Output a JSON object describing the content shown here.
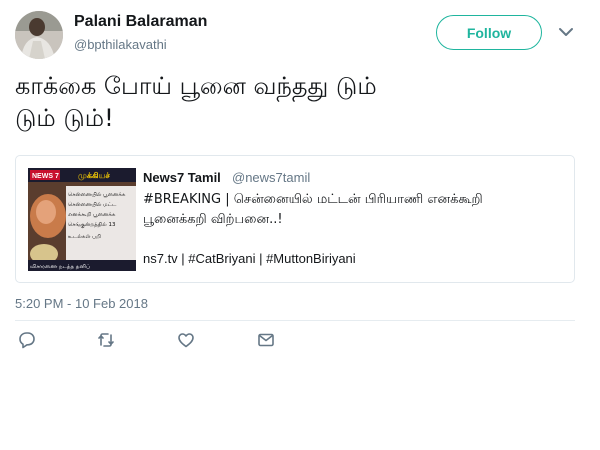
{
  "tweet": {
    "author_name": "Palani Balaraman",
    "author_handle": "@bpthilakavathi",
    "follow_label": "Follow",
    "text_line1": "காக்கை போய் பூனை வந்தது டும்",
    "text_line2": "டும் டும்!",
    "timestamp": "5:20 PM - 10 Feb 2018"
  },
  "quoted": {
    "name": "News7 Tamil",
    "handle": "@news7tamil",
    "text_line1": "#BREAKING | சென்னையில் மட்டன் பிரியாணி எனக்கூறி",
    "text_line2": "பூனைக்கறி விற்பனை..!",
    "links": "ns7.tv | #CatBriyani | #MuttonBiriyani",
    "thumb_logo": "NEWS 7",
    "thumb_logo_tamil": "முக்கியச்",
    "thumb_lines": [
      "சென்னையில் பூனைக்க",
      "சென்னையில் மட்ட",
      "எனக்கூறி பூனைக்க",
      "செங்குன்றத்தில் 13",
      "உடல்கள் பறி",
      "விசாரணை நடத்த தனிப்"
    ]
  },
  "actions": [
    {
      "name": "reply-icon"
    },
    {
      "name": "retweet-icon"
    },
    {
      "name": "like-icon"
    },
    {
      "name": "message-icon"
    }
  ],
  "colors": {
    "follow_accent": "#1fb59e",
    "secondary_text": "#657786",
    "icon_gray": "#657786"
  }
}
